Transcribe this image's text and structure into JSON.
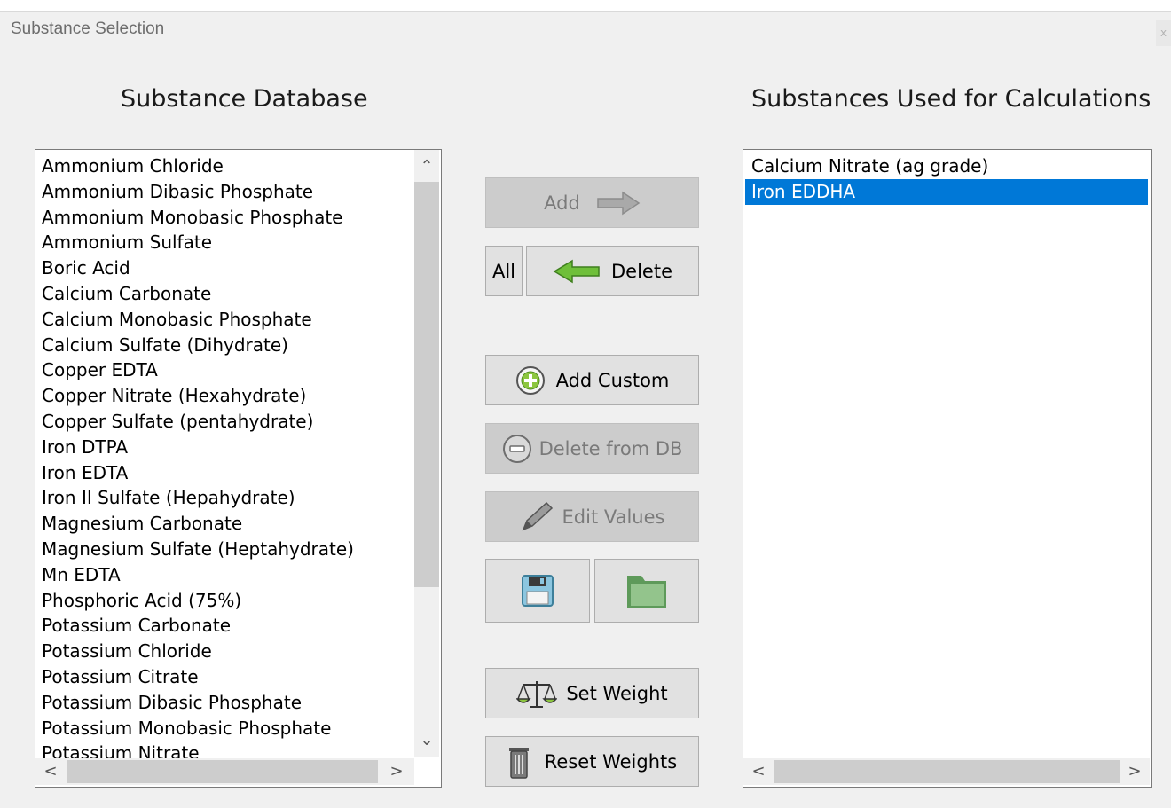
{
  "window": {
    "title": "Substance Selection",
    "close_glyph": "x"
  },
  "database": {
    "heading": "Substance Database",
    "items": [
      "Ammonium Chloride",
      "Ammonium Dibasic Phosphate",
      "Ammonium Monobasic Phosphate",
      "Ammonium Sulfate",
      "Boric Acid",
      "Calcium Carbonate",
      "Calcium Monobasic Phosphate",
      "Calcium Sulfate (Dihydrate)",
      "Copper EDTA",
      "Copper Nitrate (Hexahydrate)",
      "Copper Sulfate (pentahydrate)",
      "Iron DTPA",
      "Iron EDTA",
      "Iron II Sulfate (Hepahydrate)",
      "Magnesium Carbonate",
      "Magnesium Sulfate (Heptahydrate)",
      "Mn EDTA",
      "Phosphoric Acid (75%)",
      "Potassium Carbonate",
      "Potassium Chloride",
      "Potassium Citrate",
      "Potassium Dibasic Phosphate",
      "Potassium Monobasic Phosphate",
      "Potassium Nitrate"
    ]
  },
  "used": {
    "heading": "Substances Used for Calculations",
    "items": [
      "Calcium Nitrate (ag grade)",
      "Iron EDDHA"
    ],
    "selected": "Iron EDDHA"
  },
  "buttons": {
    "add": "Add",
    "all": "All",
    "delete": "Delete",
    "add_custom": "Add Custom",
    "delete_from_db": "Delete from DB",
    "edit_values": "Edit Values",
    "set_weight": "Set Weight",
    "reset_weights": "Reset Weights"
  },
  "colors": {
    "selection": "#0078d7",
    "green_arrow": "#6fbf3a",
    "folder": "#6ea46a"
  }
}
